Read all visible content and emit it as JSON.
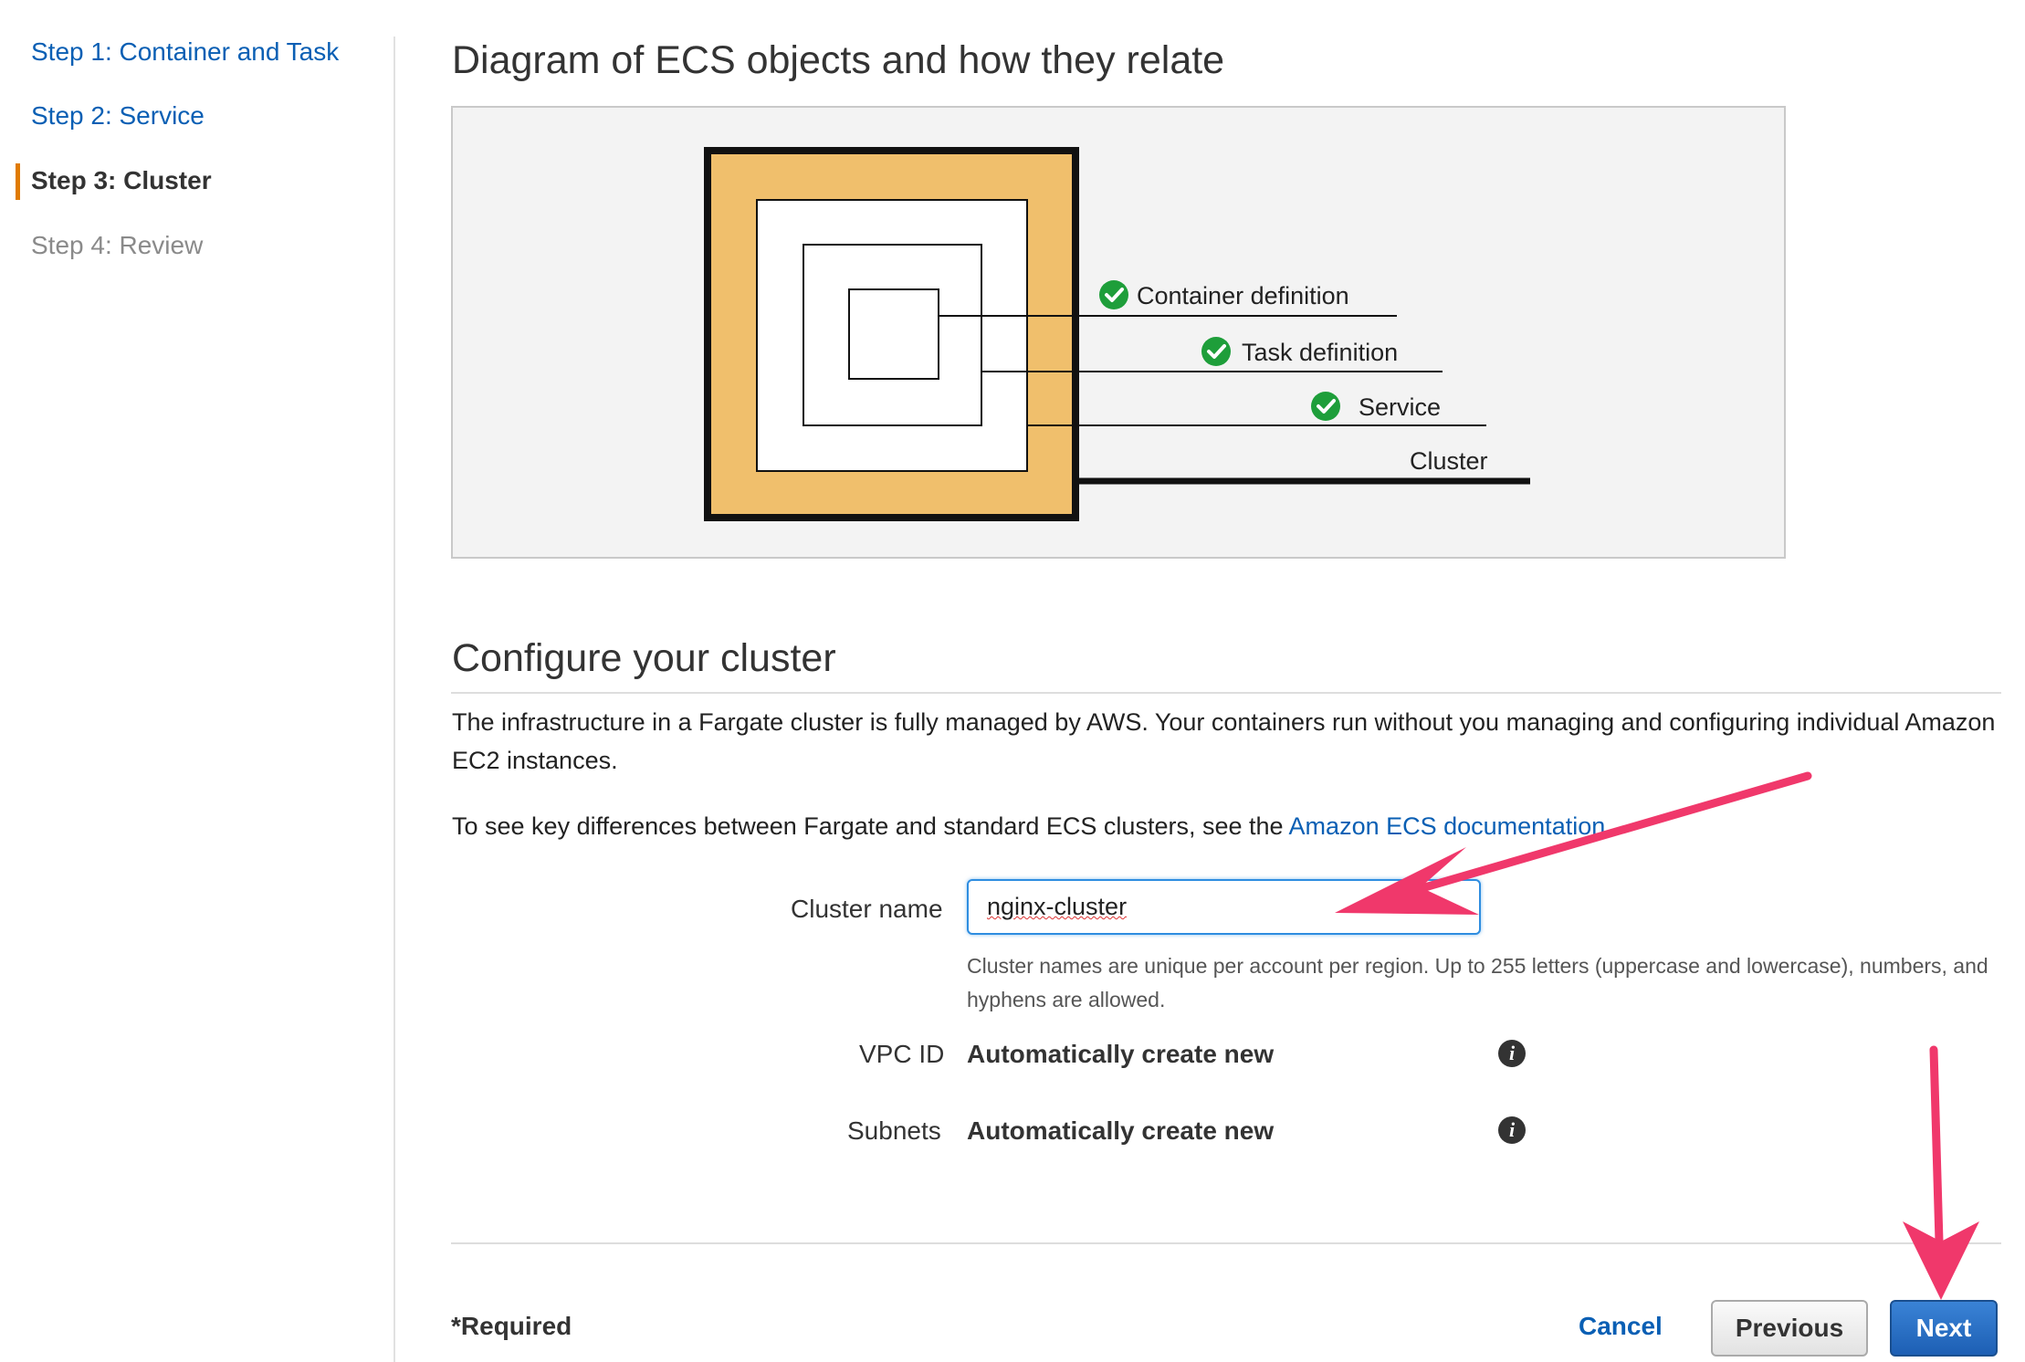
{
  "sidebar": {
    "steps": [
      {
        "label": "Step 1: Container and Task",
        "state": "link"
      },
      {
        "label": "Step 2: Service",
        "state": "link"
      },
      {
        "label": "Step 3: Cluster",
        "state": "active"
      },
      {
        "label": "Step 4: Review",
        "state": "disabled"
      }
    ],
    "active_color": "#e07b00"
  },
  "diagram": {
    "title": "Diagram of ECS objects and how they relate",
    "labels": {
      "container": "Container definition",
      "task": "Task definition",
      "service": "Service",
      "cluster": "Cluster"
    },
    "fill_color": "#f0bf6c",
    "check_color": "#1e9e3a"
  },
  "configure": {
    "title": "Configure your cluster",
    "description": "The infrastructure in a Fargate cluster is fully managed by AWS. Your containers run without you managing and configuring individual Amazon EC2 instances.",
    "doc_prefix": "To see key differences between Fargate and standard ECS clusters, see the ",
    "doc_link": "Amazon ECS documentation",
    "doc_suffix": ".",
    "cluster_name_label": "Cluster name",
    "cluster_name_value": "nginx-cluster",
    "cluster_name_hint": "Cluster names are unique per account per region. Up to 255 letters (uppercase and lowercase), numbers, and hyphens are allowed.",
    "vpc_label": "VPC ID",
    "vpc_value": "Automatically create new",
    "subnets_label": "Subnets",
    "subnets_value": "Automatically create new",
    "info_glyph": "i"
  },
  "footer": {
    "required": "*Required",
    "cancel": "Cancel",
    "previous": "Previous",
    "next": "Next"
  },
  "annotation_color": "#f0386b",
  "accent_color": "#0a5fb4"
}
